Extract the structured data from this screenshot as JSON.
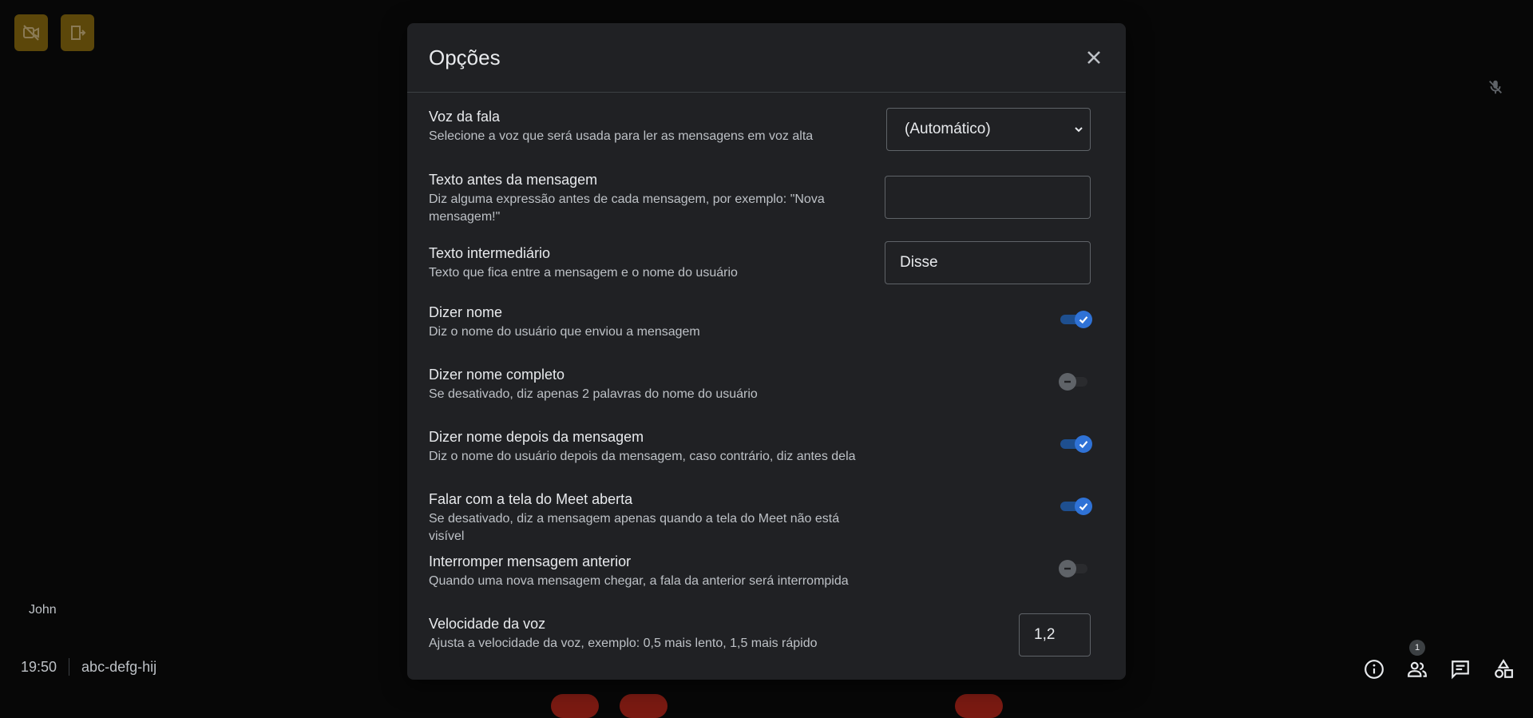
{
  "top_left": {
    "camera_off_icon": "video-off-icon",
    "leave_icon": "exit-door-icon"
  },
  "participant": {
    "name": "John"
  },
  "meeting": {
    "time": "19:50",
    "code": "abc-defg-hij"
  },
  "bottom_bar": {
    "people_count": "1"
  },
  "dialog": {
    "title": "Opções",
    "options": {
      "voice": {
        "label": "Voz da fala",
        "desc": "Selecione a voz que será usada para ler as mensagens em voz alta",
        "value": "(Automático)"
      },
      "text_before": {
        "label": "Texto antes da mensagem",
        "desc": "Diz alguma expressão antes de cada mensagem, por exemplo: \"Nova mensagem!\"",
        "value": ""
      },
      "text_between": {
        "label": "Texto intermediário",
        "desc": "Texto que fica entre a mensagem e o nome do usuário",
        "value": "Disse"
      },
      "say_name": {
        "label": "Dizer nome",
        "desc": "Diz o nome do usuário que enviou a mensagem",
        "enabled": true
      },
      "say_full_name": {
        "label": "Dizer nome completo",
        "desc": "Se desativado, diz apenas 2 palavras do nome do usuário",
        "enabled": false
      },
      "name_after": {
        "label": "Dizer nome depois da mensagem",
        "desc": "Diz o nome do usuário depois da mensagem, caso contrário, diz antes dela",
        "enabled": true
      },
      "speak_meet_open": {
        "label": "Falar com a tela do Meet aberta",
        "desc": "Se desativado, diz a mensagem apenas quando a tela do Meet não está visível",
        "enabled": true
      },
      "interrupt_previous": {
        "label": "Interromper mensagem anterior",
        "desc": "Quando uma nova mensagem chegar, a fala da anterior será interrompida",
        "enabled": false
      },
      "voice_speed": {
        "label": "Velocidade da voz",
        "desc": "Ajusta a velocidade da voz, exemplo: 0,5 mais lento, 1,5 mais rápido",
        "value": "1,2"
      }
    }
  },
  "colors": {
    "accent": "#2f72d6",
    "dialog_bg": "#202124",
    "page_bg": "#070707",
    "highlight_yellow": "#5c470a"
  }
}
